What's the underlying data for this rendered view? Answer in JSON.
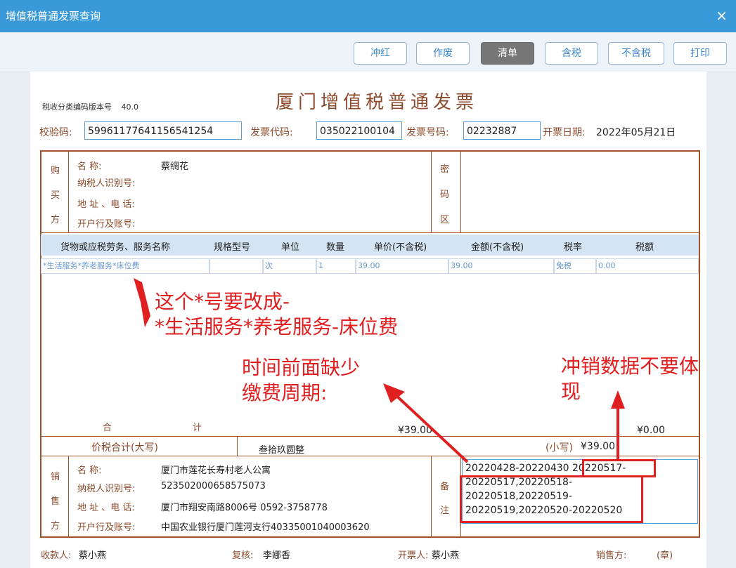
{
  "window": {
    "title": "增值税普通发票查询",
    "close_glyph": "×"
  },
  "toolbar": {
    "buttons": [
      "冲红",
      "作废",
      "清单",
      "含税",
      "不含税",
      "打印"
    ]
  },
  "invoice": {
    "version_label": "税收分类编码版本号",
    "version": "40.0",
    "title": "厦门增值税普通发票",
    "check_code_label": "校验码:",
    "check_code": "59961177641156541254",
    "code_label": "发票代码:",
    "code": "035022100104",
    "number_label": "发票号码:",
    "number": "02232887",
    "date_label": "开票日期:",
    "date": "2022年05月21日",
    "buyer": {
      "side": [
        "购",
        "买",
        "方"
      ],
      "name_label": "名        称:",
      "name": "蔡绸花",
      "tax_label": "纳税人识别号:",
      "addr_label": "地 址 、电 话:",
      "bank_label": "开户行及账号:"
    },
    "cipher_side": [
      "密",
      "码",
      "区"
    ],
    "columns": [
      "货物或应税劳务、服务名称",
      "规格型号",
      "单位",
      "数量",
      "单价(不含税)",
      "金额(不含税)",
      "税率",
      "税额"
    ],
    "item": {
      "name": "*生活服务*养老服务*床位费",
      "spec": "",
      "unit": "次",
      "qty": "1",
      "price": "39.00",
      "amount": "39.00",
      "rate": "免税",
      "tax": "0.00"
    },
    "total_label_a": "合",
    "total_label_b": "计",
    "total_amount": "¥39.00",
    "total_tax": "¥0.00",
    "grand_label": "价税合计(大写)",
    "grand_words": "叁拾玖圆整",
    "grand_small_label": "(小写)",
    "grand_small": "¥39.00",
    "seller": {
      "side": [
        "销",
        "售",
        "方"
      ],
      "name_label": "名        称:",
      "name": "厦门市莲花长寿村老人公寓",
      "tax_label": "纳税人识别号:",
      "tax_id": "523502000658575073",
      "addr_label": "地 址 、电 话:",
      "addr": "厦门市翔安南路8006号 0592-3758778",
      "bank_label": "开户行及账号:",
      "bank": "中国农业银行厦门莲河支行40335001040003620"
    },
    "remark_side": [
      "备",
      "注"
    ],
    "remark_lines": [
      "20220428-20220430 20220517-",
      "20220517,20220518-",
      "20220518,20220519-",
      "20220519,20220520-20220520"
    ],
    "footer": {
      "payee_label": "收款人:",
      "payee": "蔡小燕",
      "reviewer_label": "复核:",
      "reviewer": "李娜香",
      "issuer_label": "开票人:",
      "issuer": "蔡小燕",
      "seller_label": "销售方:",
      "stamp": "(章)"
    }
  },
  "annotations": {
    "note1": [
      "这个*号要改成-",
      "*生活服务*养老服务-床位费"
    ],
    "note2": [
      "时间前面缺少",
      "缴费周期:"
    ],
    "note3": [
      "冲销数据不要体",
      "现"
    ],
    "color": "#e02020"
  }
}
